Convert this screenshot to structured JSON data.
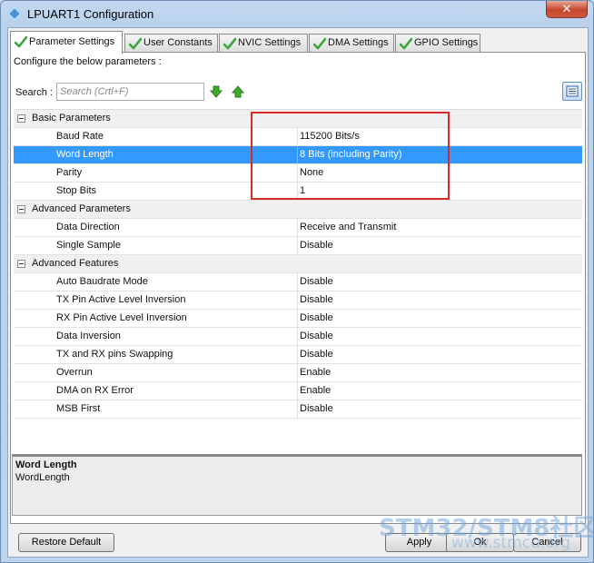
{
  "window": {
    "title": "LPUART1 Configuration",
    "close_label": "✕"
  },
  "tabs": [
    {
      "label": "Parameter Settings",
      "active": true
    },
    {
      "label": "User Constants",
      "active": false
    },
    {
      "label": "NVIC Settings",
      "active": false
    },
    {
      "label": "DMA Settings",
      "active": false
    },
    {
      "label": "GPIO Settings",
      "active": false
    }
  ],
  "panel": {
    "configure_label": "Configure the below parameters :",
    "search_label": "Search :",
    "search_placeholder": "Search (Crtl+F)"
  },
  "groups": {
    "basic": {
      "name": "Basic Parameters",
      "params": [
        {
          "name": "Baud Rate",
          "value": "115200 Bits/s"
        },
        {
          "name": "Word Length",
          "value": "8 Bits (including Parity)"
        },
        {
          "name": "Parity",
          "value": "None"
        },
        {
          "name": "Stop Bits",
          "value": "1"
        }
      ]
    },
    "advanced": {
      "name": "Advanced Parameters",
      "params": [
        {
          "name": "Data Direction",
          "value": "Receive and Transmit"
        },
        {
          "name": "Single Sample",
          "value": "Disable"
        }
      ]
    },
    "features": {
      "name": "Advanced Features",
      "params": [
        {
          "name": "Auto Baudrate Mode",
          "value": "Disable"
        },
        {
          "name": "TX Pin Active Level Inversion",
          "value": "Disable"
        },
        {
          "name": "RX Pin Active Level Inversion",
          "value": "Disable"
        },
        {
          "name": "Data Inversion",
          "value": "Disable"
        },
        {
          "name": "TX and RX pins Swapping",
          "value": "Disable"
        },
        {
          "name": "Overrun",
          "value": "Enable"
        },
        {
          "name": "DMA on RX Error",
          "value": "Enable"
        },
        {
          "name": "MSB First",
          "value": "Disable"
        }
      ]
    }
  },
  "description": {
    "title": "Word Length",
    "subtitle": "WordLength"
  },
  "buttons": {
    "restore": "Restore Default",
    "apply": "Apply",
    "ok": "Ok",
    "cancel": "Cancel"
  },
  "watermark": {
    "main": "STM32/STM8社区",
    "sub": "www.stmcu.org"
  },
  "colors": {
    "selection": "#3399ff",
    "highlight_box": "#d62b2b",
    "check": "#3aa53a"
  },
  "selected_param": "Word Length"
}
